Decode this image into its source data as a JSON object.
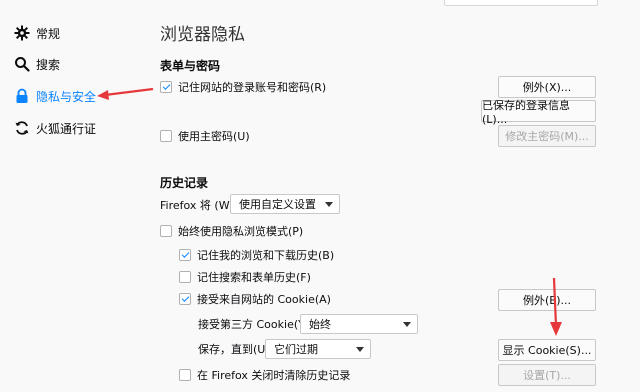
{
  "sidebar": {
    "items": [
      {
        "label": "常规",
        "icon": "gear-icon"
      },
      {
        "label": "搜索",
        "icon": "search-icon"
      },
      {
        "label": "隐私与安全",
        "icon": "lock-icon"
      },
      {
        "label": "火狐通行证",
        "icon": "sync-icon"
      }
    ],
    "active_index": 2
  },
  "page": {
    "title": "浏览器隐私"
  },
  "forms": {
    "heading": "表单与密码",
    "remember_logins": {
      "label": "记住网站的登录账号和密码(R)",
      "checked": true
    },
    "exceptions_button": "例外(X)...",
    "saved_logins_button": "已保存的登录信息(L)...",
    "master_password": {
      "label": "使用主密码(U)",
      "checked": false
    },
    "change_master_button": "修改主密码(M)..."
  },
  "history": {
    "heading": "历史记录",
    "firefox_will_label": "Firefox 将 (W)",
    "firefox_will_value": "使用自定义设置",
    "always_private": {
      "label": "始终使用隐私浏览模式(P)",
      "checked": false
    },
    "remember_history": {
      "label": "记住我的浏览和下载历史(B)",
      "checked": true
    },
    "remember_search": {
      "label": "记住搜索和表单历史(F)",
      "checked": false
    },
    "accept_cookies": {
      "label": "接受来自网站的 Cookie(A)",
      "checked": true
    },
    "cookie_exceptions_button": "例外(E)...",
    "third_party_label": "接受第三方 Cookie(Y)",
    "third_party_value": "始终",
    "keep_until_label": "保存，直到(U)",
    "keep_until_value": "它们过期",
    "show_cookies_button": "显示 Cookie(S)...",
    "clear_on_close": {
      "label": "在 Firefox 关闭时清除历史记录",
      "checked": false
    },
    "settings_button": "设置(T)..."
  },
  "colors": {
    "accent": "#0a84ff",
    "annotation_arrow": "#e5383b"
  }
}
